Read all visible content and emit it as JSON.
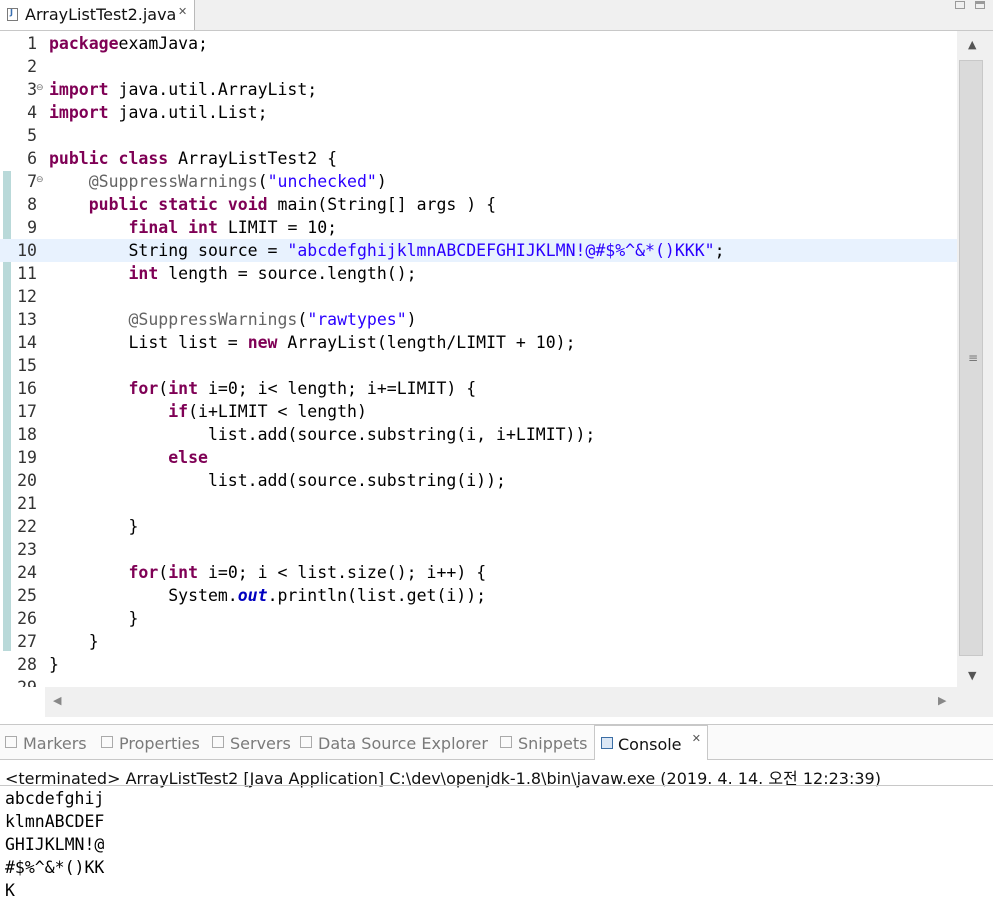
{
  "editor_tab": {
    "title": "ArrayListTest2.java",
    "close": "✕"
  },
  "code_lines": [
    {
      "n": "1",
      "fold": "",
      "seg": [
        [
          "kw",
          "package"
        ],
        [
          "",
          "examJava;"
        ]
      ]
    },
    {
      "n": "2",
      "fold": "",
      "seg": []
    },
    {
      "n": "3",
      "fold": "⊖",
      "seg": [
        [
          "kw",
          "import"
        ],
        [
          "",
          " java.util.ArrayList;"
        ]
      ]
    },
    {
      "n": "4",
      "fold": "",
      "seg": [
        [
          "kw",
          "import"
        ],
        [
          "",
          " java.util.List;"
        ]
      ]
    },
    {
      "n": "5",
      "fold": "",
      "seg": []
    },
    {
      "n": "6",
      "fold": "",
      "seg": [
        [
          "kw",
          "public"
        ],
        [
          "",
          " "
        ],
        [
          "kw",
          "class"
        ],
        [
          "",
          " ArrayListTest2 {"
        ]
      ]
    },
    {
      "n": "7",
      "fold": "⊖",
      "seg": [
        [
          "",
          "    "
        ],
        [
          "ann",
          "@SuppressWarnings"
        ],
        [
          "",
          "("
        ],
        [
          "str",
          "\"unchecked\""
        ],
        [
          "",
          ")"
        ]
      ]
    },
    {
      "n": "8",
      "fold": "",
      "seg": [
        [
          "",
          "    "
        ],
        [
          "kw",
          "public"
        ],
        [
          "",
          " "
        ],
        [
          "kw",
          "static"
        ],
        [
          "",
          " "
        ],
        [
          "kw",
          "void"
        ],
        [
          "",
          " main(String[] "
        ],
        [
          "",
          "args"
        ],
        [
          "",
          " ) {"
        ]
      ]
    },
    {
      "n": "9",
      "fold": "",
      "seg": [
        [
          "",
          "        "
        ],
        [
          "kw",
          "final"
        ],
        [
          "",
          " "
        ],
        [
          "kw",
          "int"
        ],
        [
          "",
          " LIMIT = 10;"
        ]
      ]
    },
    {
      "n": "10",
      "fold": "",
      "seg": [
        [
          "",
          "        String source = "
        ],
        [
          "str",
          "\"abcdefghijklmnABCDEFGHIJKLMN!@#$%^&*()KKK\""
        ],
        [
          "",
          ";"
        ]
      ]
    },
    {
      "n": "11",
      "fold": "",
      "seg": [
        [
          "",
          "        "
        ],
        [
          "kw",
          "int"
        ],
        [
          "",
          " length = source.length();"
        ]
      ]
    },
    {
      "n": "12",
      "fold": "",
      "seg": []
    },
    {
      "n": "13",
      "fold": "",
      "seg": [
        [
          "",
          "        "
        ],
        [
          "ann",
          "@SuppressWarnings"
        ],
        [
          "",
          "("
        ],
        [
          "str",
          "\"rawtypes\""
        ],
        [
          "",
          ")"
        ]
      ]
    },
    {
      "n": "14",
      "fold": "",
      "seg": [
        [
          "",
          "        List list = "
        ],
        [
          "kw",
          "new"
        ],
        [
          "",
          " ArrayList(length/LIMIT + 10);"
        ]
      ]
    },
    {
      "n": "15",
      "fold": "",
      "seg": []
    },
    {
      "n": "16",
      "fold": "",
      "seg": [
        [
          "",
          "        "
        ],
        [
          "kw",
          "for"
        ],
        [
          "",
          "("
        ],
        [
          "kw",
          "int"
        ],
        [
          "",
          " i=0; i< length; i+=LIMIT) {"
        ]
      ]
    },
    {
      "n": "17",
      "fold": "",
      "seg": [
        [
          "",
          "            "
        ],
        [
          "kw",
          "if"
        ],
        [
          "",
          "(i+LIMIT < length)"
        ]
      ]
    },
    {
      "n": "18",
      "fold": "",
      "seg": [
        [
          "",
          "                list.add(source.substring(i, i+LIMIT));"
        ]
      ]
    },
    {
      "n": "19",
      "fold": "",
      "seg": [
        [
          "",
          "            "
        ],
        [
          "kw",
          "else"
        ]
      ]
    },
    {
      "n": "20",
      "fold": "",
      "seg": [
        [
          "",
          "                list.add(source.substring(i));"
        ]
      ]
    },
    {
      "n": "21",
      "fold": "",
      "seg": []
    },
    {
      "n": "22",
      "fold": "",
      "seg": [
        [
          "",
          "        }"
        ]
      ]
    },
    {
      "n": "23",
      "fold": "",
      "seg": []
    },
    {
      "n": "24",
      "fold": "",
      "seg": [
        [
          "",
          "        "
        ],
        [
          "kw",
          "for"
        ],
        [
          "",
          "("
        ],
        [
          "kw",
          "int"
        ],
        [
          "",
          " i=0; i < list.size(); i++) {"
        ]
      ]
    },
    {
      "n": "25",
      "fold": "",
      "seg": [
        [
          "",
          "            System."
        ],
        [
          "sfld",
          "out"
        ],
        [
          "",
          ".println(list.get(i));"
        ]
      ]
    },
    {
      "n": "26",
      "fold": "",
      "seg": [
        [
          "",
          "        }"
        ]
      ]
    },
    {
      "n": "27",
      "fold": "",
      "seg": [
        [
          "",
          "    }"
        ]
      ]
    },
    {
      "n": "28",
      "fold": "",
      "seg": [
        [
          "",
          "}"
        ]
      ]
    },
    {
      "n": "29",
      "fold": "",
      "seg": []
    }
  ],
  "current_line": "10",
  "scroll": {
    "up": "▲",
    "down": "▼",
    "left": "◀",
    "right": "▶",
    "grip": "≡"
  },
  "view_tabs": [
    {
      "label": "Markers",
      "icon": "markers-icon",
      "active": false
    },
    {
      "label": "Properties",
      "icon": "properties-icon",
      "active": false
    },
    {
      "label": "Servers",
      "icon": "servers-icon",
      "active": false
    },
    {
      "label": "Data Source Explorer",
      "icon": "data-source-icon",
      "active": false
    },
    {
      "label": "Snippets",
      "icon": "snippets-icon",
      "active": false
    },
    {
      "label": "Console",
      "icon": "console-icon",
      "active": true,
      "close": "✕"
    }
  ],
  "console": {
    "status": "<terminated> ArrayListTest2 [Java Application] C:\\dev\\openjdk-1.8\\bin\\javaw.exe (2019. 4. 14. 오전 12:23:39)",
    "output": [
      "abcdefghij",
      "klmnABCDEF",
      "GHIJKLMN!@",
      "#$%^&*()KK",
      "K"
    ]
  }
}
